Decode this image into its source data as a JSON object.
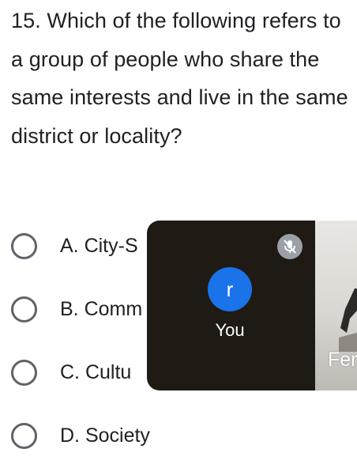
{
  "question": {
    "text": "15. Which of the following refers to a group of people who share the same interests and live in the same district or locality?"
  },
  "options": [
    {
      "label": "A.  City-S"
    },
    {
      "label": "B. Comm"
    },
    {
      "label": "C. Cultu"
    },
    {
      "label": "D. Society"
    }
  ],
  "meeting_overlay": {
    "self_avatar_initial": "r",
    "self_label": "You",
    "mic_icon": "mic-off-icon",
    "other_participant_name": "Fer"
  },
  "colors": {
    "text": "#202124",
    "radio_border": "#5f6368",
    "overlay_bg": "#1f1a14",
    "avatar_bg": "#1a73e8"
  }
}
